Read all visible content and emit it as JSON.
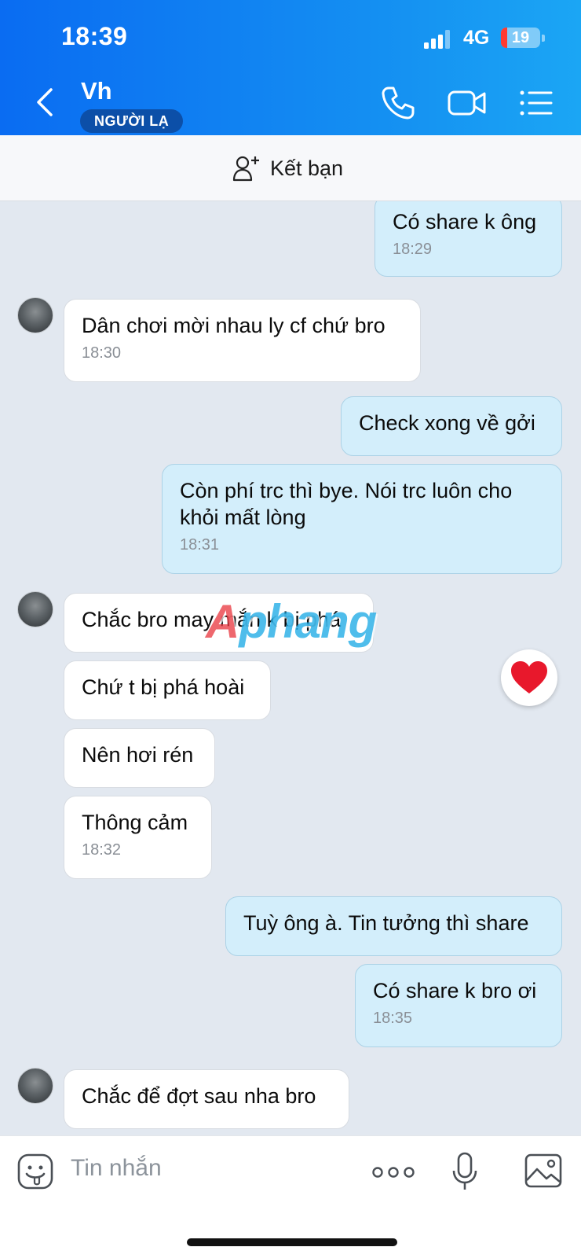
{
  "status_bar": {
    "time": "18:39",
    "network": "4G",
    "battery": "19"
  },
  "header": {
    "name": "Vh",
    "badge": "NGƯỜI LẠ"
  },
  "add_friend": {
    "label": "Kết bạn"
  },
  "messages": [
    {
      "side": "me",
      "text": "Có share k ông",
      "time": "18:29"
    },
    {
      "side": "them",
      "text": "Dân chơi mời nhau ly cf chứ bro",
      "time": "18:30"
    },
    {
      "side": "me",
      "text": "Check xong về gởi",
      "time": ""
    },
    {
      "side": "me",
      "text": "Còn phí trc thì bye. Nói trc luôn cho khỏi mất lòng",
      "time": "18:31"
    },
    {
      "side": "them",
      "text": "Chắc bro may mắn k bị phá",
      "time": ""
    },
    {
      "side": "them",
      "text": "Chứ t bị phá hoài",
      "time": ""
    },
    {
      "side": "them",
      "text": "Nên hơi rén",
      "time": ""
    },
    {
      "side": "them",
      "text": "Thông cảm",
      "time": "18:32"
    },
    {
      "side": "me",
      "text": "Tuỳ ông à. Tin tưởng thì share",
      "time": ""
    },
    {
      "side": "me",
      "text": "Có share k bro ơi",
      "time": "18:35"
    },
    {
      "side": "them",
      "text": "Chắc để đợt sau nha bro",
      "time": ""
    }
  ],
  "watermark": {
    "a": "A",
    "rest": "phang"
  },
  "input": {
    "placeholder": "Tin nhắn"
  },
  "colors": {
    "header": "#0a6cf2",
    "my_bubble": "#d3eefb",
    "their_bubble": "#ffffff",
    "chat_bg": "#e2e8f0"
  }
}
